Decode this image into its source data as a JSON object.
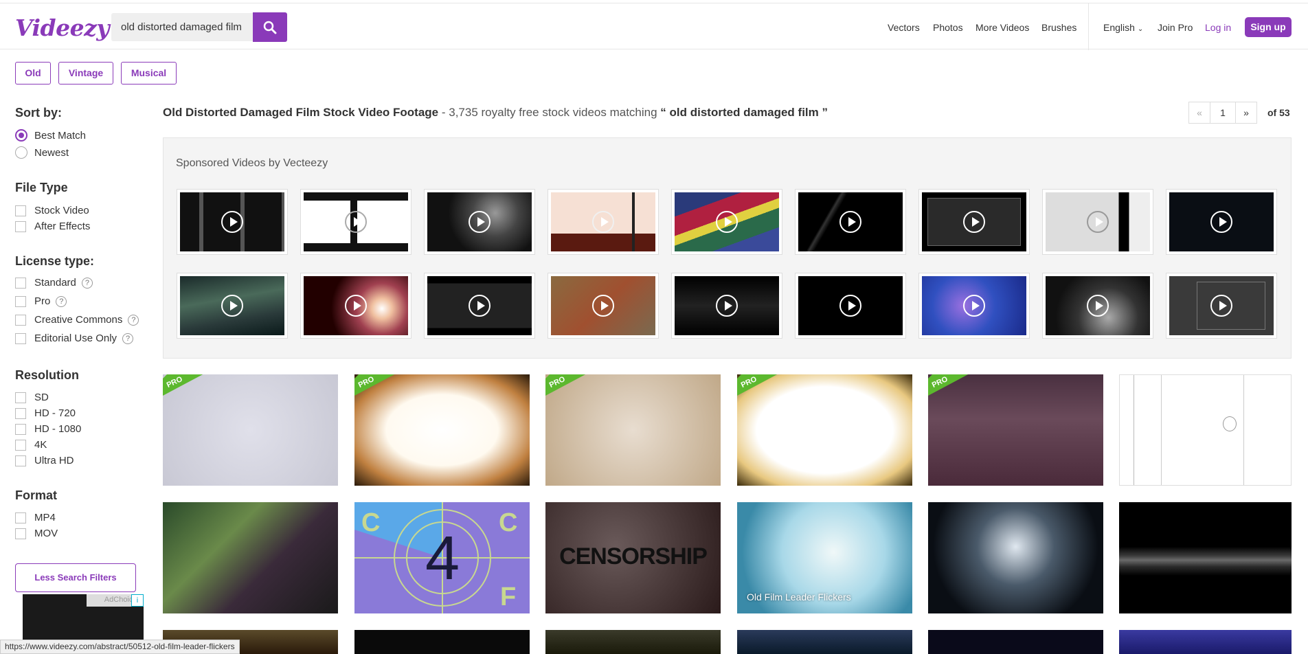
{
  "header": {
    "logo": "Videezy",
    "search_value": "old distorted damaged film",
    "nav": [
      "Vectors",
      "Photos",
      "More Videos",
      "Brushes"
    ],
    "language": "English",
    "join_pro": "Join Pro",
    "login": "Log in",
    "signup": "Sign up"
  },
  "tags": [
    "Old",
    "Vintage",
    "Musical"
  ],
  "sidebar": {
    "sort_heading": "Sort by:",
    "sort_options": [
      "Best Match",
      "Newest"
    ],
    "sort_selected": "Best Match",
    "file_type_heading": "File Type",
    "file_types": [
      "Stock Video",
      "After Effects"
    ],
    "license_heading": "License type:",
    "licenses": [
      "Standard",
      "Pro",
      "Creative Commons",
      "Editorial Use Only"
    ],
    "resolution_heading": "Resolution",
    "resolutions": [
      "SD",
      "HD - 720",
      "HD - 1080",
      "4K",
      "Ultra HD"
    ],
    "format_heading": "Format",
    "formats": [
      "MP4",
      "MOV"
    ],
    "less_filters": "Less Search Filters",
    "ad_label": "AdChoices",
    "ad_icon": "i"
  },
  "results": {
    "title": "Old Distorted Damaged Film Stock Video Footage",
    "subtitle_prefix": " - 3,735 royalty free stock videos matching ",
    "query_quoted": "“ old distorted damaged film ”",
    "page": "1",
    "of_pages": "of 53"
  },
  "sponsored": {
    "title": "Sponsored Videos by Vecteezy"
  },
  "tiles": {
    "pro_label": "PRO",
    "caption_leader": "Old Film Leader Flickers",
    "countdown_number": "4",
    "countdown_letters": [
      "C",
      "C",
      "F"
    ],
    "censorship_text": "CENSORSHIP"
  },
  "status_url": "https://www.videezy.com/abstract/50512-old-film-leader-flickers",
  "colors": {
    "brand": "#8a3ab9",
    "pro_green": "#5cb82e"
  }
}
